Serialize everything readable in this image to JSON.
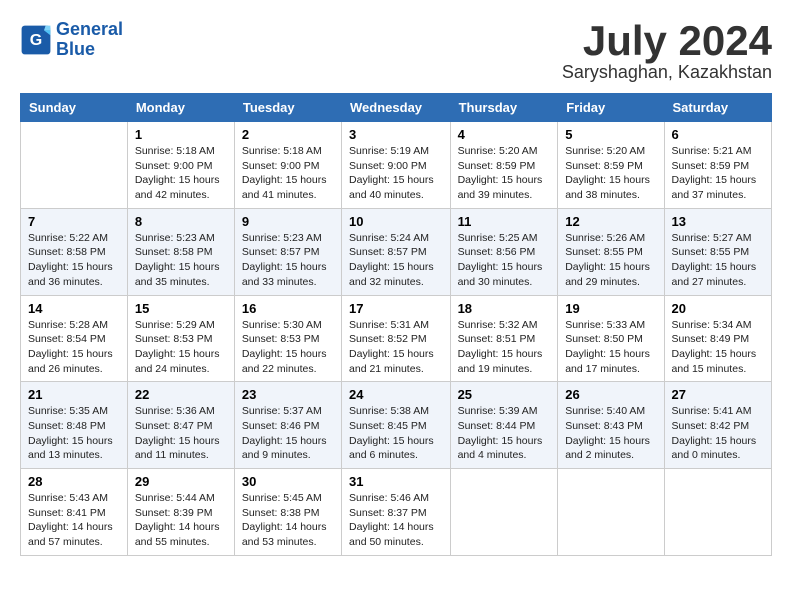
{
  "logo": {
    "line1": "General",
    "line2": "Blue"
  },
  "title": "July 2024",
  "subtitle": "Saryshaghan, Kazakhstan",
  "weekdays": [
    "Sunday",
    "Monday",
    "Tuesday",
    "Wednesday",
    "Thursday",
    "Friday",
    "Saturday"
  ],
  "weeks": [
    [
      {
        "day": "",
        "sunrise": "",
        "sunset": "",
        "daylight": ""
      },
      {
        "day": "1",
        "sunrise": "Sunrise: 5:18 AM",
        "sunset": "Sunset: 9:00 PM",
        "daylight": "Daylight: 15 hours and 42 minutes."
      },
      {
        "day": "2",
        "sunrise": "Sunrise: 5:18 AM",
        "sunset": "Sunset: 9:00 PM",
        "daylight": "Daylight: 15 hours and 41 minutes."
      },
      {
        "day": "3",
        "sunrise": "Sunrise: 5:19 AM",
        "sunset": "Sunset: 9:00 PM",
        "daylight": "Daylight: 15 hours and 40 minutes."
      },
      {
        "day": "4",
        "sunrise": "Sunrise: 5:20 AM",
        "sunset": "Sunset: 8:59 PM",
        "daylight": "Daylight: 15 hours and 39 minutes."
      },
      {
        "day": "5",
        "sunrise": "Sunrise: 5:20 AM",
        "sunset": "Sunset: 8:59 PM",
        "daylight": "Daylight: 15 hours and 38 minutes."
      },
      {
        "day": "6",
        "sunrise": "Sunrise: 5:21 AM",
        "sunset": "Sunset: 8:59 PM",
        "daylight": "Daylight: 15 hours and 37 minutes."
      }
    ],
    [
      {
        "day": "7",
        "sunrise": "Sunrise: 5:22 AM",
        "sunset": "Sunset: 8:58 PM",
        "daylight": "Daylight: 15 hours and 36 minutes."
      },
      {
        "day": "8",
        "sunrise": "Sunrise: 5:23 AM",
        "sunset": "Sunset: 8:58 PM",
        "daylight": "Daylight: 15 hours and 35 minutes."
      },
      {
        "day": "9",
        "sunrise": "Sunrise: 5:23 AM",
        "sunset": "Sunset: 8:57 PM",
        "daylight": "Daylight: 15 hours and 33 minutes."
      },
      {
        "day": "10",
        "sunrise": "Sunrise: 5:24 AM",
        "sunset": "Sunset: 8:57 PM",
        "daylight": "Daylight: 15 hours and 32 minutes."
      },
      {
        "day": "11",
        "sunrise": "Sunrise: 5:25 AM",
        "sunset": "Sunset: 8:56 PM",
        "daylight": "Daylight: 15 hours and 30 minutes."
      },
      {
        "day": "12",
        "sunrise": "Sunrise: 5:26 AM",
        "sunset": "Sunset: 8:55 PM",
        "daylight": "Daylight: 15 hours and 29 minutes."
      },
      {
        "day": "13",
        "sunrise": "Sunrise: 5:27 AM",
        "sunset": "Sunset: 8:55 PM",
        "daylight": "Daylight: 15 hours and 27 minutes."
      }
    ],
    [
      {
        "day": "14",
        "sunrise": "Sunrise: 5:28 AM",
        "sunset": "Sunset: 8:54 PM",
        "daylight": "Daylight: 15 hours and 26 minutes."
      },
      {
        "day": "15",
        "sunrise": "Sunrise: 5:29 AM",
        "sunset": "Sunset: 8:53 PM",
        "daylight": "Daylight: 15 hours and 24 minutes."
      },
      {
        "day": "16",
        "sunrise": "Sunrise: 5:30 AM",
        "sunset": "Sunset: 8:53 PM",
        "daylight": "Daylight: 15 hours and 22 minutes."
      },
      {
        "day": "17",
        "sunrise": "Sunrise: 5:31 AM",
        "sunset": "Sunset: 8:52 PM",
        "daylight": "Daylight: 15 hours and 21 minutes."
      },
      {
        "day": "18",
        "sunrise": "Sunrise: 5:32 AM",
        "sunset": "Sunset: 8:51 PM",
        "daylight": "Daylight: 15 hours and 19 minutes."
      },
      {
        "day": "19",
        "sunrise": "Sunrise: 5:33 AM",
        "sunset": "Sunset: 8:50 PM",
        "daylight": "Daylight: 15 hours and 17 minutes."
      },
      {
        "day": "20",
        "sunrise": "Sunrise: 5:34 AM",
        "sunset": "Sunset: 8:49 PM",
        "daylight": "Daylight: 15 hours and 15 minutes."
      }
    ],
    [
      {
        "day": "21",
        "sunrise": "Sunrise: 5:35 AM",
        "sunset": "Sunset: 8:48 PM",
        "daylight": "Daylight: 15 hours and 13 minutes."
      },
      {
        "day": "22",
        "sunrise": "Sunrise: 5:36 AM",
        "sunset": "Sunset: 8:47 PM",
        "daylight": "Daylight: 15 hours and 11 minutes."
      },
      {
        "day": "23",
        "sunrise": "Sunrise: 5:37 AM",
        "sunset": "Sunset: 8:46 PM",
        "daylight": "Daylight: 15 hours and 9 minutes."
      },
      {
        "day": "24",
        "sunrise": "Sunrise: 5:38 AM",
        "sunset": "Sunset: 8:45 PM",
        "daylight": "Daylight: 15 hours and 6 minutes."
      },
      {
        "day": "25",
        "sunrise": "Sunrise: 5:39 AM",
        "sunset": "Sunset: 8:44 PM",
        "daylight": "Daylight: 15 hours and 4 minutes."
      },
      {
        "day": "26",
        "sunrise": "Sunrise: 5:40 AM",
        "sunset": "Sunset: 8:43 PM",
        "daylight": "Daylight: 15 hours and 2 minutes."
      },
      {
        "day": "27",
        "sunrise": "Sunrise: 5:41 AM",
        "sunset": "Sunset: 8:42 PM",
        "daylight": "Daylight: 15 hours and 0 minutes."
      }
    ],
    [
      {
        "day": "28",
        "sunrise": "Sunrise: 5:43 AM",
        "sunset": "Sunset: 8:41 PM",
        "daylight": "Daylight: 14 hours and 57 minutes."
      },
      {
        "day": "29",
        "sunrise": "Sunrise: 5:44 AM",
        "sunset": "Sunset: 8:39 PM",
        "daylight": "Daylight: 14 hours and 55 minutes."
      },
      {
        "day": "30",
        "sunrise": "Sunrise: 5:45 AM",
        "sunset": "Sunset: 8:38 PM",
        "daylight": "Daylight: 14 hours and 53 minutes."
      },
      {
        "day": "31",
        "sunrise": "Sunrise: 5:46 AM",
        "sunset": "Sunset: 8:37 PM",
        "daylight": "Daylight: 14 hours and 50 minutes."
      },
      {
        "day": "",
        "sunrise": "",
        "sunset": "",
        "daylight": ""
      },
      {
        "day": "",
        "sunrise": "",
        "sunset": "",
        "daylight": ""
      },
      {
        "day": "",
        "sunrise": "",
        "sunset": "",
        "daylight": ""
      }
    ]
  ]
}
